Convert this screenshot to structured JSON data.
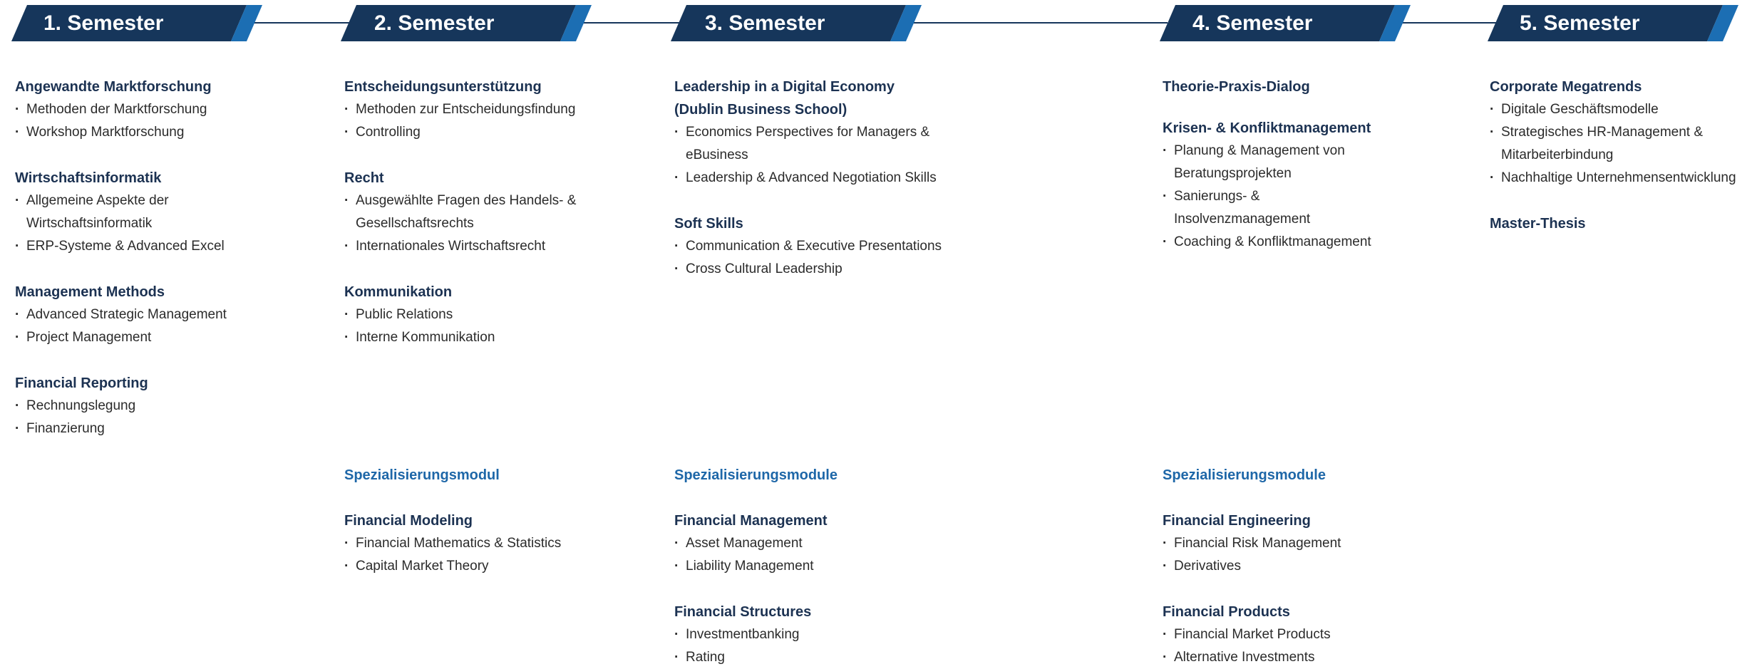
{
  "semesters": [
    {
      "label": "1. Semester",
      "modules": [
        {
          "title": "Angewandte Marktforschung",
          "items": [
            "Methoden der Marktforschung",
            "Workshop Marktforschung"
          ]
        },
        {
          "title": "Wirtschaftsinformatik",
          "items": [
            "Allgemeine Aspekte der Wirtschaftsinformatik",
            "ERP-Systeme & Advanced Excel"
          ]
        },
        {
          "title": "Management Methods",
          "items": [
            "Advanced Strategic Management",
            "Project Management"
          ]
        },
        {
          "title": "Financial Reporting",
          "items": [
            "Rechnungslegung",
            "Finanzierung"
          ]
        }
      ]
    },
    {
      "label": "2. Semester",
      "modules": [
        {
          "title": "Entscheidungsunterstützung",
          "items": [
            "Methoden zur Entscheidungsfindung",
            "Controlling"
          ]
        },
        {
          "title": "Recht",
          "items": [
            "Ausgewählte Fragen des Handels- & Gesellschaftsrechts",
            "Internationales Wirtschaftsrecht"
          ]
        },
        {
          "title": "Kommunikation",
          "items": [
            "Public Relations",
            "Interne Kommunikation"
          ]
        }
      ],
      "specialization": {
        "heading": "Spezialisierungsmodul",
        "modules": [
          {
            "title": "Financial Modeling",
            "items": [
              "Financial Mathematics & Statistics",
              "Capital Market Theory"
            ]
          }
        ]
      }
    },
    {
      "label": "3. Semester",
      "modules": [
        {
          "title": "Leadership in a Digital Economy (Dublin Business School)",
          "items": [
            "Economics Perspectives for Managers & eBusiness",
            "Leadership & Advanced Negotiation Skills"
          ]
        },
        {
          "title": "Soft Skills",
          "items": [
            "Communication & Executive Presentations",
            "Cross Cultural Leadership"
          ]
        }
      ],
      "specialization": {
        "heading": "Spezialisierungsmodule",
        "modules": [
          {
            "title": "Financial Management",
            "items": [
              "Asset Management",
              "Liability Management"
            ]
          },
          {
            "title": "Financial Structures",
            "items": [
              "Investmentbanking",
              "Rating"
            ]
          }
        ]
      }
    },
    {
      "label": "4. Semester",
      "modules": [
        {
          "title": "Theorie-Praxis-Dialog",
          "items": []
        },
        {
          "title": "Krisen- & Konfliktmanagement",
          "items": [
            "Planung & Management von Beratungsprojekten",
            "Sanierungs- & Insolvenzmanagement",
            "Coaching & Konfliktmanagement"
          ]
        }
      ],
      "specialization": {
        "heading": "Spezialisierungsmodule",
        "modules": [
          {
            "title": "Financial Engineering",
            "items": [
              "Financial Risk Management",
              "Derivatives"
            ]
          },
          {
            "title": "Financial Products",
            "items": [
              "Financial Market Products",
              "Alternative Investments"
            ]
          }
        ]
      }
    },
    {
      "label": "5. Semester",
      "modules": [
        {
          "title": "Corporate Megatrends",
          "items": [
            "Digitale Geschäftsmodelle",
            "Strategisches HR-Management & Mitarbeiterbindung",
            "Nachhaltige Unternehmensentwicklung"
          ]
        },
        {
          "title": "Master-Thesis",
          "items": []
        }
      ]
    }
  ]
}
